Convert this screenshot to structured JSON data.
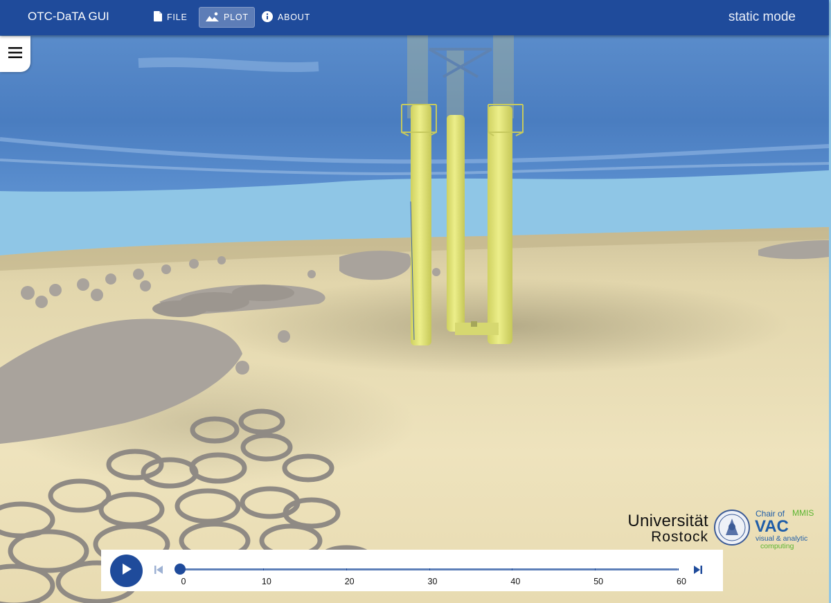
{
  "appbar": {
    "title": "OTC-DaTA GUI",
    "nav": [
      {
        "label": "FILE",
        "icon": "file-icon",
        "active": false
      },
      {
        "label": "PLOT",
        "icon": "image-icon",
        "active": true
      },
      {
        "label": "ABOUT",
        "icon": "info-icon",
        "active": false
      }
    ],
    "mode": "static mode"
  },
  "menu": {
    "icon": "hamburger-menu-icon"
  },
  "logos": {
    "university_line1": "Universität",
    "university_line2": "Rostock",
    "chair": "Chair of",
    "mmis": "MMIS",
    "vac": "VAC",
    "vac_line1": "visual & analytic",
    "vac_line2": "computing"
  },
  "timeline": {
    "play_icon": "play-icon",
    "prev_icon": "skip-previous-icon",
    "next_icon": "skip-next-icon",
    "min": 0,
    "max": 60,
    "value": 0,
    "ticks": [
      "0",
      "10",
      "20",
      "30",
      "40",
      "50",
      "60"
    ]
  },
  "colors": {
    "appbar": "#1f4b9b",
    "structure": "#e6e87a",
    "sand": "#e9ddb4",
    "water_surface": "#4f82c6",
    "sky": "#8fc6e6",
    "reef": "#a8a29c"
  }
}
